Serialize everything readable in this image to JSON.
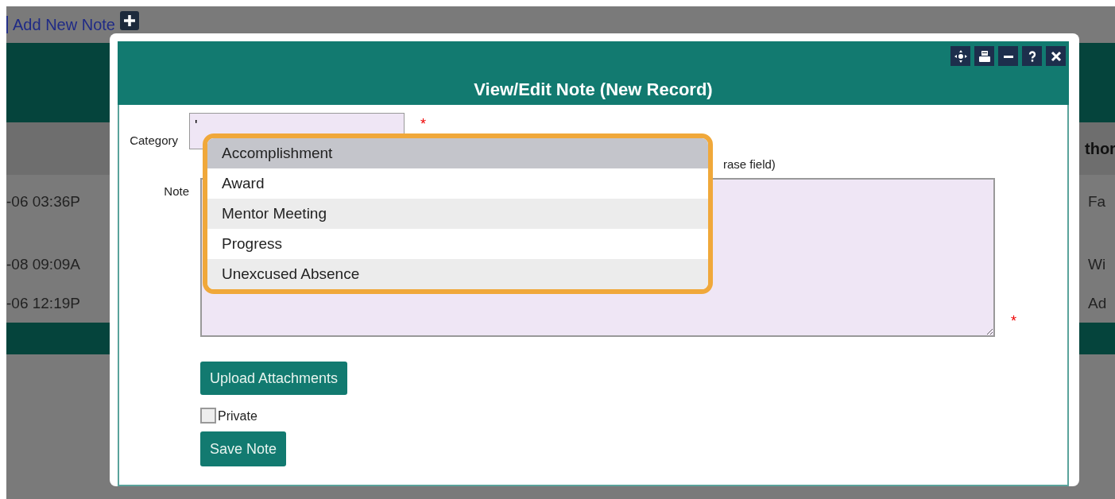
{
  "background": {
    "add_link": "Add New Note",
    "header_right": "thor",
    "rows": [
      {
        "time": "-06 03:36P",
        "name": "Fa"
      },
      {
        "time": "-08 09:09A",
        "name": "Wi"
      },
      {
        "time": "-06 12:19P",
        "name": "Ad"
      }
    ]
  },
  "dialog": {
    "title": "View/Edit Note (New Record)",
    "fields": {
      "category_label": "Category",
      "category_value": "'",
      "hint": "rase field)",
      "note_label": "Note",
      "required_mark": "*"
    },
    "dropdown": [
      {
        "label": "Accomplishment",
        "selected": true
      },
      {
        "label": "Award",
        "selected": false
      },
      {
        "label": "Mentor Meeting",
        "selected": false
      },
      {
        "label": "Progress",
        "selected": false
      },
      {
        "label": "Unexcused Absence",
        "selected": false
      }
    ],
    "upload_button": "Upload Attachments",
    "private": {
      "label": "Private",
      "checked": false
    },
    "save_button": "Save Note"
  }
}
